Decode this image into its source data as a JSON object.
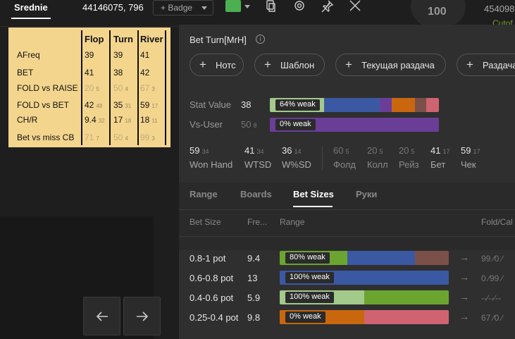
{
  "topbar": {
    "name": "Srednie",
    "id": "44146075, 796",
    "badge": "+ Badge",
    "color": "#4caf50",
    "icons": [
      "copy-icon",
      "gear-icon",
      "pin-icon",
      "close-icon"
    ]
  },
  "right_fragment": {
    "number": "100",
    "id": "454098",
    "green": "Cutof"
  },
  "hud": {
    "columns": [
      "Flop",
      "Turn",
      "River"
    ],
    "rows": [
      {
        "label": "AFreq",
        "cells": [
          {
            "v": "39",
            "s": ""
          },
          {
            "v": "39",
            "s": ""
          },
          {
            "v": "41",
            "s": ""
          }
        ]
      },
      {
        "label": "BET",
        "cells": [
          {
            "v": "41",
            "s": ""
          },
          {
            "v": "38",
            "s": ""
          },
          {
            "v": "42",
            "s": ""
          }
        ]
      },
      {
        "label": "FOLD vs RAISE",
        "cells": [
          {
            "v": "20",
            "s": "5",
            "dim": true
          },
          {
            "v": "50",
            "s": "4",
            "dim": true
          },
          {
            "v": "67",
            "s": "3",
            "dim": true
          }
        ]
      },
      {
        "label": "FOLD vs BET",
        "cells": [
          {
            "v": "42",
            "s": "48"
          },
          {
            "v": "35",
            "s": "31"
          },
          {
            "v": "59",
            "s": "17"
          }
        ]
      },
      {
        "label": "CH/R",
        "cells": [
          {
            "v": "9.4",
            "s": "32"
          },
          {
            "v": "17",
            "s": "18"
          },
          {
            "v": "18",
            "s": "11"
          }
        ]
      },
      {
        "label": "Bet vs miss CB",
        "cells": [
          {
            "v": "71",
            "s": "7",
            "dim": true
          },
          {
            "v": "50",
            "s": "4",
            "dim": true
          },
          {
            "v": "99",
            "s": "3",
            "dim": true
          }
        ]
      }
    ]
  },
  "popup": {
    "title": "Bet Turn[MrH]",
    "chips": [
      "Нотс",
      "Шаблон",
      "Текущая раздача",
      "Раздача"
    ],
    "stat_value": {
      "label": "Stat Value",
      "value": "38",
      "tag": "64% weak"
    },
    "vs_user": {
      "label": "Vs-User",
      "value": "50",
      "sub": "8",
      "tag": "0% weak"
    },
    "mini_stats": [
      {
        "n": "59",
        "s": "34",
        "l": "Won Hand"
      },
      {
        "n": "41",
        "s": "34",
        "l": "WTSD"
      },
      {
        "n": "36",
        "s": "14",
        "l": "W%SD"
      },
      {
        "n": "60",
        "s": "5",
        "l": "Фолд",
        "dim": true
      },
      {
        "n": "20",
        "s": "5",
        "l": "Колл",
        "dim": true
      },
      {
        "n": "20",
        "s": "5",
        "l": "Рейз",
        "dim": true
      },
      {
        "n": "41",
        "s": "17",
        "l": "Бет"
      },
      {
        "n": "59",
        "s": "17",
        "l": "Чек"
      }
    ],
    "tabs": [
      "Range",
      "Boards",
      "Bet Sizes",
      "Руки"
    ],
    "active_tab": "Bet Sizes",
    "col_headers": [
      "Bet Size",
      "Fre...",
      "Range",
      "Fold/Cal"
    ],
    "bet_sizes": [
      {
        "label": "0.8-1 pot",
        "freq": "9.4",
        "tag": "80% weak",
        "fold": "99 ∕0 ∕"
      },
      {
        "label": "0.6-0.8 pot",
        "freq": "13",
        "tag": "100% weak",
        "fold": "0 ∕99 ∕"
      },
      {
        "label": "0.4-0.6 pot",
        "freq": "5.9",
        "tag": "100% weak",
        "fold": "--∕--∕--"
      },
      {
        "label": "0.25-0.4 pot",
        "freq": "9.8",
        "tag": "0% weak",
        "fold": "67 ∕0 ∕"
      }
    ]
  },
  "colors": {
    "hud_bg": "#f4d58d",
    "weak_green_light": "#a3c98b",
    "green": "#6ba530",
    "blue": "#3b58a3",
    "purple": "#6a3e97",
    "orange": "#c9670f",
    "brown": "#7a5048",
    "pink": "#cf6370"
  }
}
